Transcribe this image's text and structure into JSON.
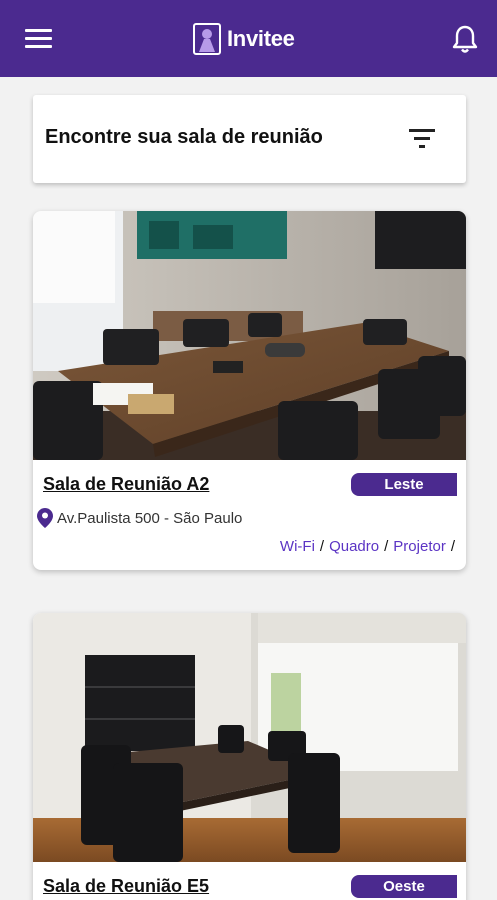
{
  "app": {
    "name": "Invitee",
    "brand_color": "#4b2a8f",
    "icons": {
      "menu": "hamburger-menu-icon",
      "notifications": "bell-icon",
      "filter": "filter-icon",
      "location": "location-pin-icon"
    }
  },
  "search": {
    "title": "Encontre sua sala de reunião"
  },
  "rooms": [
    {
      "name": "Sala de Reunião A2",
      "region": "Leste",
      "address": "Av.Paulista 500 - São Paulo",
      "amenities": [
        "Wi-Fi",
        "Quadro",
        "Projetor"
      ]
    },
    {
      "name": "Sala de Reunião E5",
      "region": "Oeste"
    }
  ]
}
